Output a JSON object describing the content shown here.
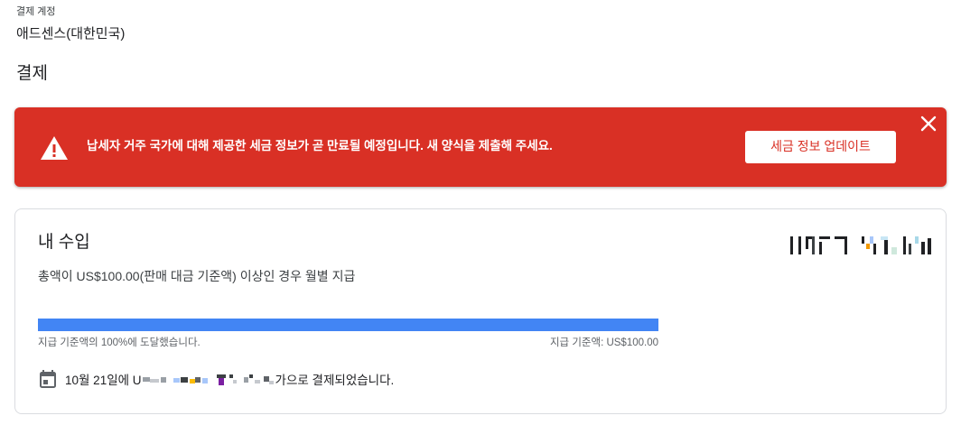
{
  "account": {
    "label": "결제 계정",
    "name": "애드센스(대한민국)"
  },
  "page": {
    "title": "결제"
  },
  "alert": {
    "message": "납세자 거주 국가에 대해 제공한 세금 정보가 곧 만료될 예정입니다. 새 양식을 제출해 주세요.",
    "button_label": "세금 정보 업데이트",
    "background_color": "#d93025",
    "icon": "warning-icon",
    "close_icon": "close-icon"
  },
  "earnings": {
    "title": "내 수입",
    "description": "총액이 US$100.00(판매 대금 기준액) 이상인 경우 월별 지급",
    "progress_percent": 100,
    "progress_color": "#4285f4",
    "progress_left_label": "지급 기준액의 100%에 도달했습니다.",
    "progress_right_label": "지급 기준액: US$100.00",
    "payment_prefix": "10월 21일에 U",
    "payment_suffix": "가으로 결제되었습니다.",
    "calendar_icon": "calendar-icon"
  }
}
